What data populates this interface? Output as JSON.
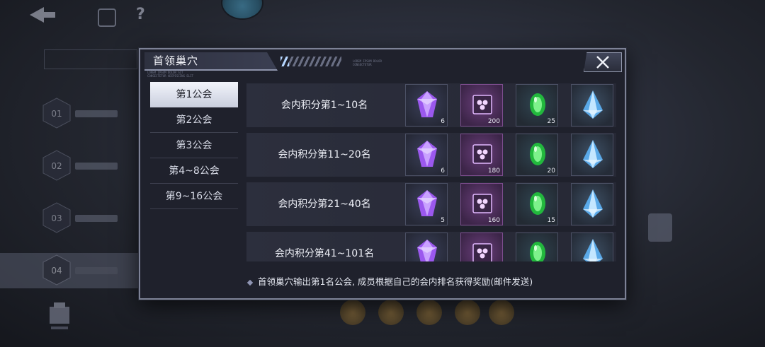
{
  "background": {
    "menu_steps": [
      "01",
      "02",
      "03",
      "04"
    ]
  },
  "dialog": {
    "title": "首领巢穴",
    "deco_text_left": "LOREM IPSUM DOLOR SIT\nCONSECTETUR ADIPISCING ELIT",
    "deco_text_right": "LOREM IPSUM DOLOR\nCONSECTETUR",
    "close_icon": "close-x-icon",
    "tabs": [
      {
        "label": "第1公会",
        "active": true
      },
      {
        "label": "第2公会",
        "active": false
      },
      {
        "label": "第3公会",
        "active": false
      },
      {
        "label": "第4~8公会",
        "active": false
      },
      {
        "label": "第9~16公会",
        "active": false
      }
    ],
    "rows": [
      {
        "label": "会内积分第1~10名",
        "rewards": [
          {
            "icon": "purple-gem-icon",
            "count": "6"
          },
          {
            "icon": "chip-icon",
            "count": "200"
          },
          {
            "icon": "emerald-icon",
            "count": "25"
          },
          {
            "icon": "ice-crystal-icon",
            "count": ""
          }
        ]
      },
      {
        "label": "会内积分第11~20名",
        "rewards": [
          {
            "icon": "purple-gem-icon",
            "count": "6"
          },
          {
            "icon": "chip-icon",
            "count": "180"
          },
          {
            "icon": "emerald-icon",
            "count": "20"
          },
          {
            "icon": "ice-crystal-icon",
            "count": ""
          }
        ]
      },
      {
        "label": "会内积分第21~40名",
        "rewards": [
          {
            "icon": "purple-gem-icon",
            "count": "5"
          },
          {
            "icon": "chip-icon",
            "count": "160"
          },
          {
            "icon": "emerald-icon",
            "count": "15"
          },
          {
            "icon": "ice-crystal-icon",
            "count": ""
          }
        ]
      },
      {
        "label": "会内积分第41~101名",
        "rewards": [
          {
            "icon": "purple-gem-icon",
            "count": ""
          },
          {
            "icon": "chip-icon",
            "count": ""
          },
          {
            "icon": "emerald-icon",
            "count": ""
          },
          {
            "icon": "ice-crystal-icon",
            "count": ""
          }
        ]
      }
    ],
    "note": "首领巢穴输出第1名公会, 成员根据自己的会内排名获得奖励(邮件发送)"
  },
  "colors": {
    "dialog_bg": "#1f212c",
    "tab_active": "#e6e9f3",
    "gem_purple": "#a25cf0",
    "emerald": "#2fcf4a",
    "crystal": "#7fc6ff"
  }
}
